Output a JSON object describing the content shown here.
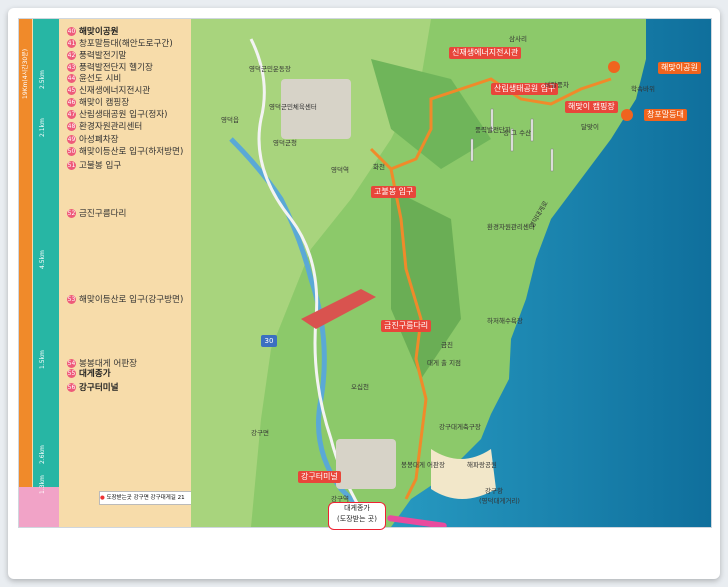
{
  "side_panel": {
    "distances": [
      "19Km(4시간30분)",
      "2.5km",
      "2.1km",
      "4.5km",
      "1.5km",
      "2.6km",
      "1.3km"
    ],
    "stops": [
      {
        "num": "40",
        "name": "해맞이공원",
        "bold": true
      },
      {
        "num": "41",
        "name": "창포말등대(해안도로구간)",
        "bold": false
      },
      {
        "num": "42",
        "name": "풍력발전기말",
        "bold": false
      },
      {
        "num": "43",
        "name": "풍력발전단지 헬기장",
        "bold": false
      },
      {
        "num": "44",
        "name": "윤선도 시비",
        "bold": false
      },
      {
        "num": "45",
        "name": "신재생에너지전시관",
        "bold": false
      },
      {
        "num": "46",
        "name": "해맞이 캠핑장",
        "bold": false
      },
      {
        "num": "47",
        "name": "산림생태공원 입구(정자)",
        "bold": false
      },
      {
        "num": "48",
        "name": "환경자원관리센터",
        "bold": false
      },
      {
        "num": "49",
        "name": "아성폐차장",
        "bold": false
      },
      {
        "num": "50",
        "name": "해맞이등산로 입구(하저방면)",
        "bold": false
      },
      {
        "num": "51",
        "name": "고불봉 입구",
        "bold": false
      },
      {
        "num": "52",
        "name": "금진구름다리",
        "bold": false
      },
      {
        "num": "53",
        "name": "해맞이등산로 입구(강구방면)",
        "bold": false
      },
      {
        "num": "54",
        "name": "봉봉대게 어판장",
        "bold": false
      },
      {
        "num": "55",
        "name": "대게종가",
        "bold": true
      },
      {
        "num": "56",
        "name": "강구터미널",
        "bold": true
      }
    ],
    "legend": "도장받는곳 강구면 강구대게길 21"
  },
  "map": {
    "tags": [
      {
        "text": "신재생에너지전시관",
        "style": "red"
      },
      {
        "text": "산림생태공원 입구",
        "style": "red"
      },
      {
        "text": "해맞이공원",
        "style": "orange"
      },
      {
        "text": "해맞이 캠핑장",
        "style": "red"
      },
      {
        "text": "창포말등대",
        "style": "orange"
      },
      {
        "text": "고불봉 입구",
        "style": "red"
      },
      {
        "text": "금진구름다리",
        "style": "red"
      },
      {
        "text": "강구터미널",
        "style": "red"
      }
    ],
    "labels": [
      "영덕군민운동장",
      "영덕군민체육센터",
      "영덕군청",
      "영덕역",
      "영덕읍",
      "화천",
      "오십천",
      "강구역",
      "강구면",
      "강구대게축구장",
      "해파랑공원",
      "삼사리",
      "하저해수욕장",
      "강구항",
      "(영덕대게거리)",
      "금진",
      "풍력발전단지",
      "달맞이",
      "대게 출 지점",
      "환경자원관리센터",
      "봉봉대게 어판장",
      "학속바위",
      "비탈풍차",
      "영덕대게로",
      "성 그 수산"
    ],
    "finish": "대게종가\n(도장받는 곳)",
    "road_sign": "30"
  },
  "colors": {
    "route": "#f08a2a",
    "sea": "#1a8fbf",
    "land": "#8cc96a"
  }
}
